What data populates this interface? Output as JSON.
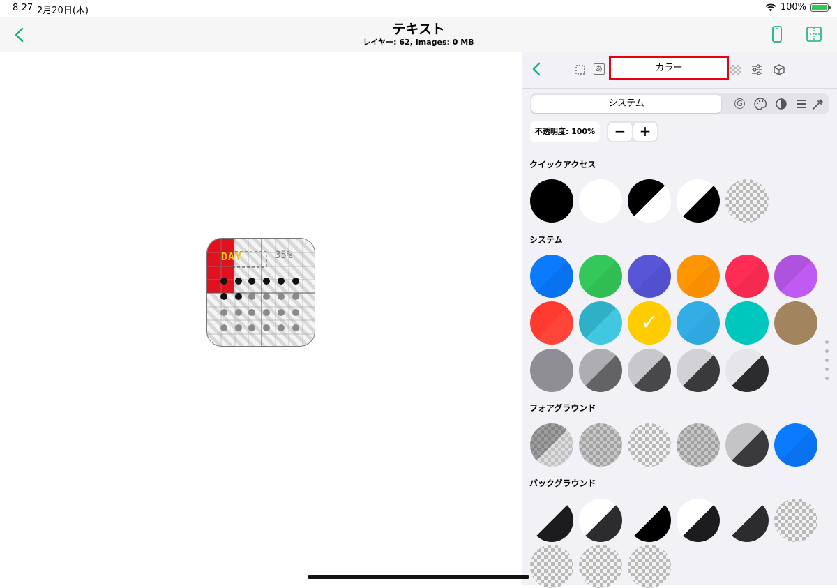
{
  "status_bar": {
    "time": "8:27",
    "date": "2月20日(木)",
    "battery_text": "100%"
  },
  "nav": {
    "title": "テキスト",
    "subtitle": "レイヤー: 62, Images: 0 MB"
  },
  "canvas": {
    "widget_day_text": "DAY",
    "widget_percent_text": "35%"
  },
  "panel": {
    "active_tab_label": "カラー",
    "tab_icons": [
      "selection-icon",
      "text-icon",
      "color-tab",
      "checkerboard-icon",
      "sliders-icon",
      "cube-icon"
    ],
    "source_segment_label": "システム",
    "source_icons": [
      "g-icon",
      "palette-icon",
      "contrast-icon",
      "list-icon",
      "eyedropper-icon"
    ],
    "opacity_label": "不透明度: 100%",
    "minus_label": "−",
    "plus_label": "+"
  },
  "sections": {
    "quick_access": "クイックアクセス",
    "system": "システム",
    "foreground": "フォアグラウンド",
    "background": "バックグラウンド"
  },
  "colors": {
    "accent": "#18b184",
    "highlight_border": "#e60012",
    "quick_access": [
      "black",
      "white",
      "black/white",
      "white/black",
      "transparent"
    ],
    "system_row1": [
      "#0a7aff",
      "#34c759",
      "#5856d6",
      "#ff9500",
      "#ff2d55",
      "#af52de"
    ],
    "system_row2": [
      "#ff3b30",
      "#30b0c7",
      "#ffcc00",
      "#32ade6",
      "#00c7be",
      "#a2845e"
    ],
    "system_row3": [
      "#8e8e93",
      "#aeaeb2/#636366",
      "#c7c7cc/#48484a",
      "#d1d1d6/#3a3a3c",
      "#e5e5ea/#2c2c2e"
    ],
    "selected_system_color": "#ffcc00"
  }
}
